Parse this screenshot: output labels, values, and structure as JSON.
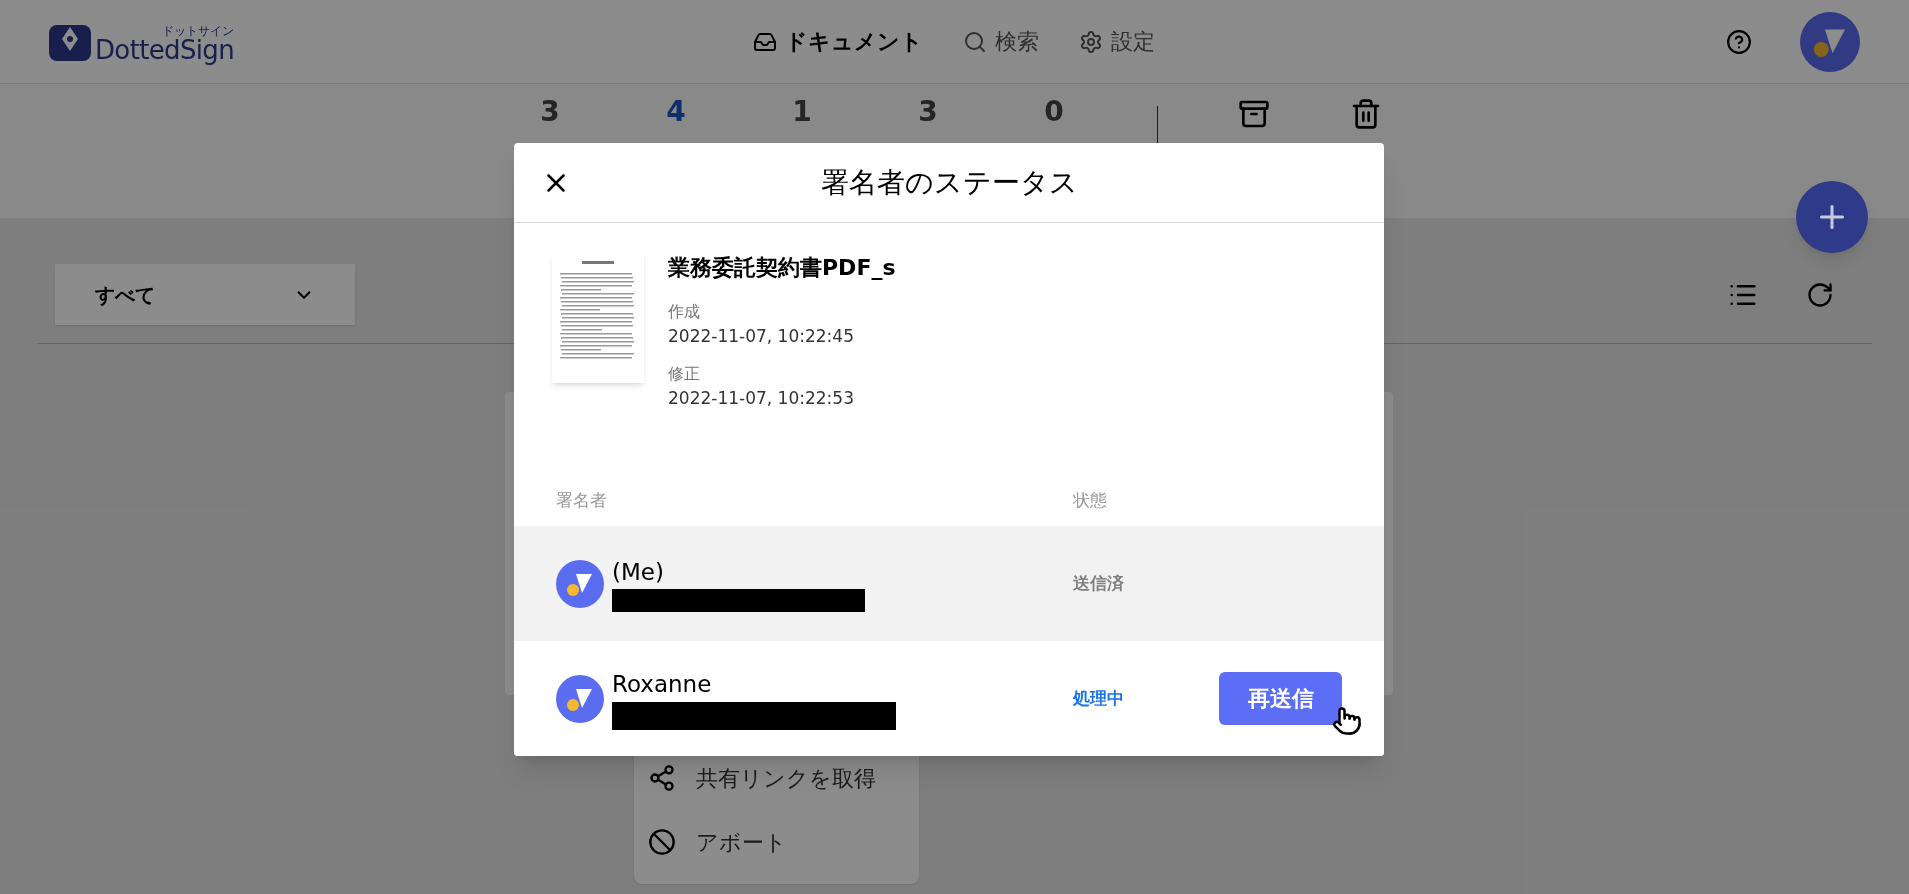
{
  "header": {
    "logo": {
      "name": "DottedSign",
      "subtitle": "ドットサイン"
    },
    "nav": [
      {
        "label": "ドキュメント",
        "selected": true
      },
      {
        "label": "検索",
        "selected": false
      },
      {
        "label": "設定",
        "selected": false
      }
    ]
  },
  "counts": [
    {
      "count": "3",
      "selected": false
    },
    {
      "count": "4",
      "selected": true
    },
    {
      "count": "1",
      "selected": false
    },
    {
      "count": "3",
      "selected": false
    },
    {
      "count": "0",
      "selected": false
    }
  ],
  "filter": {
    "value": "すべて"
  },
  "context_menu": [
    {
      "label": "共有リンクを取得"
    },
    {
      "label": "アボート"
    }
  ],
  "dialog": {
    "title": "署名者のステータス",
    "document": {
      "name": "業務委託契約書PDF_s",
      "created_label": "作成",
      "created": "2022-11-07, 10:22:45",
      "modified_label": "修正",
      "modified": "2022-11-07, 10:22:53"
    },
    "columns": [
      "署名者",
      "状態"
    ],
    "signers": [
      {
        "name": "(Me)",
        "status": "送信済",
        "kind": "sent",
        "selected": true
      },
      {
        "name": "Roxanne",
        "status": "処理中",
        "kind": "processing",
        "selected": false,
        "action": "再送信"
      }
    ]
  }
}
